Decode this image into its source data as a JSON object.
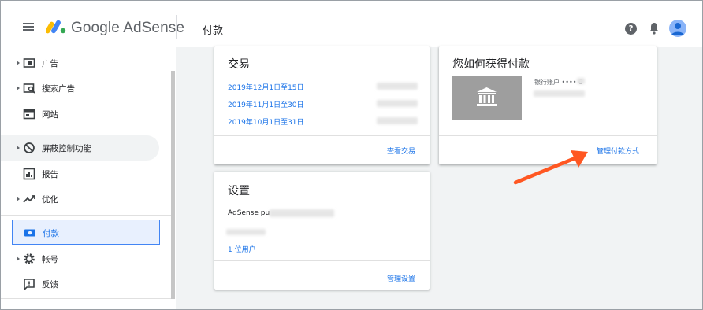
{
  "header": {
    "brand": "Google AdSense",
    "page_title": "付款",
    "help_glyph": "?"
  },
  "sidebar": {
    "items": [
      {
        "label": "广告",
        "icon": "ad-unit-icon"
      },
      {
        "label": "搜索广告",
        "icon": "search-ads-icon"
      },
      {
        "label": "网站",
        "icon": "sites-icon"
      },
      {
        "label": "屏蔽控制功能",
        "icon": "block-icon"
      },
      {
        "label": "报告",
        "icon": "report-icon"
      },
      {
        "label": "优化",
        "icon": "trending-icon"
      },
      {
        "label": "付款",
        "icon": "payment-icon"
      },
      {
        "label": "帐号",
        "icon": "settings-gear-icon"
      },
      {
        "label": "反馈",
        "icon": "feedback-icon"
      }
    ]
  },
  "transactions_card": {
    "title": "交易",
    "rows": [
      "2019年12月1日至15日",
      "2019年11月1日至30日",
      "2019年10月1日至31日"
    ],
    "footer_link": "查看交易"
  },
  "payment_method_card": {
    "title": "您如何获得付款",
    "bank_label": "银行账户 •••• 6",
    "footer_link": "管理付款方式"
  },
  "settings_card": {
    "title": "设置",
    "publisher_prefix": "AdSense pu",
    "users_link": "1 位用户",
    "footer_link": "管理设置"
  },
  "colors": {
    "accent": "#1a73e8",
    "arrow": "#ff5722",
    "active_bg": "#e8f0fe"
  }
}
